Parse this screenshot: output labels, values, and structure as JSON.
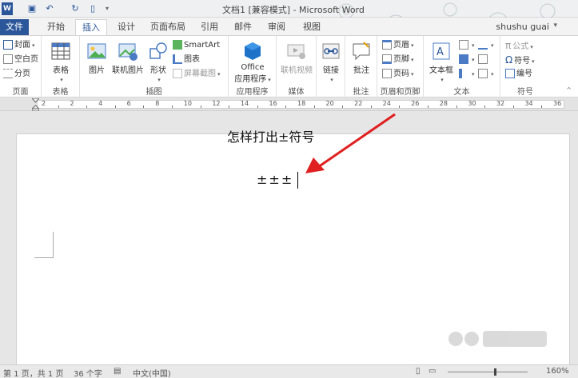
{
  "window": {
    "title": "文档1 [兼容模式] - Microsoft Word"
  },
  "quick_access": {
    "icons": [
      "word-icon",
      "save-icon",
      "undo-icon",
      "redo-icon",
      "new-doc-icon"
    ]
  },
  "tabs": {
    "file": "文件",
    "items": [
      "开始",
      "插入",
      "设计",
      "页面布局",
      "引用",
      "邮件",
      "审阅",
      "视图"
    ],
    "active": "插入"
  },
  "user": {
    "name": "shushu guai"
  },
  "ribbon": {
    "pages": {
      "cover": "封面",
      "blank": "空白页",
      "break": "分页",
      "label": "页面"
    },
    "tables": {
      "table": "表格",
      "label": "表格"
    },
    "illustrations": {
      "picture": "图片",
      "online_picture": "联机图片",
      "shapes": "形状",
      "smartart": "SmartArt",
      "chart": "图表",
      "screenshot": "屏幕截图",
      "label": "插图"
    },
    "apps": {
      "office_line1": "Office",
      "office_line2": "应用程序",
      "label": "应用程序"
    },
    "media": {
      "online_video": "联机视频",
      "label": "媒体"
    },
    "links": {
      "link": "链接",
      "label": ""
    },
    "comments": {
      "comment": "批注",
      "label": "批注"
    },
    "header_footer": {
      "header": "页眉",
      "footer": "页脚",
      "page_number": "页码",
      "label": "页眉和页脚"
    },
    "text": {
      "textbox": "文本框",
      "label": "文本"
    },
    "symbols": {
      "equation": "公式",
      "symbol": "符号",
      "number": "编号",
      "label": "符号"
    }
  },
  "ruler": {
    "ticks": [
      "2",
      "2",
      "4",
      "6",
      "8",
      "10",
      "12",
      "14",
      "16",
      "18",
      "20",
      "22",
      "24",
      "26",
      "28",
      "30",
      "32",
      "34",
      "36"
    ]
  },
  "document": {
    "title_line": "怎样打出±符号",
    "content_line": "±±±"
  },
  "status_bar": {
    "page": "第 1 页，共 1 页",
    "word_count": "36 个字",
    "language": "中文(中国)",
    "zoom": "160%"
  },
  "colors": {
    "accent": "#2b579a",
    "arrow": "#e02020"
  }
}
